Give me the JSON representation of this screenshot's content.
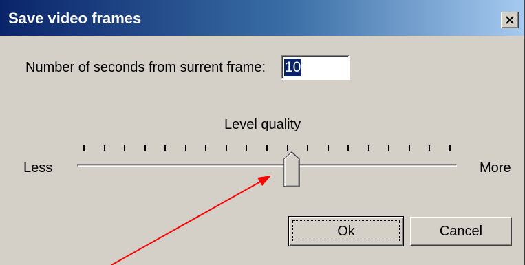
{
  "window": {
    "title": "Save video frames",
    "close_icon": "close-x-icon"
  },
  "seconds": {
    "label": "Number of seconds from surrent frame:",
    "value": "10"
  },
  "quality": {
    "label": "Level quality",
    "min_label": "Less",
    "max_label": "More",
    "tick_count": 19,
    "value_fraction": 0.57
  },
  "buttons": {
    "ok_label": "Ok",
    "cancel_label": "Cancel"
  },
  "annotation": {
    "arrow_color": "#ff0000"
  },
  "colors": {
    "title_gradient_start": "#0a246a",
    "title_gradient_end": "#a6caf0",
    "dialog_bg": "#d4d0c8",
    "selection_bg": "#0a246a"
  }
}
